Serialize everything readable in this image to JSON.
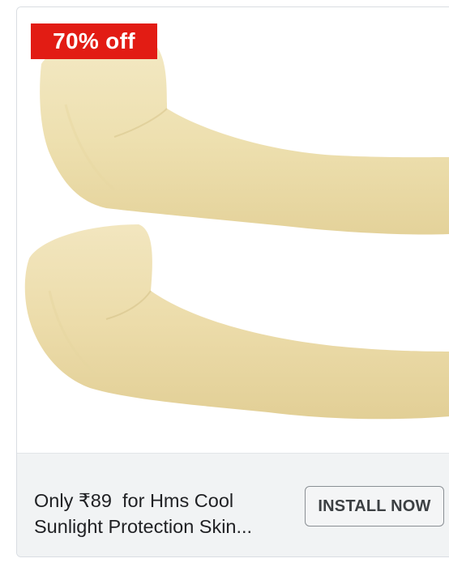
{
  "ad": {
    "badge_text": "70% off",
    "headline": "Only ₹89  for Hms Cool Sunlight Protection Skin...",
    "cta_label": "INSTALL NOW",
    "product_image": "arm-sleeve-pair"
  },
  "colors": {
    "badge_bg": "#e21c14",
    "sleeve": "#efe3b8",
    "footer_bg": "#f1f3f4"
  }
}
